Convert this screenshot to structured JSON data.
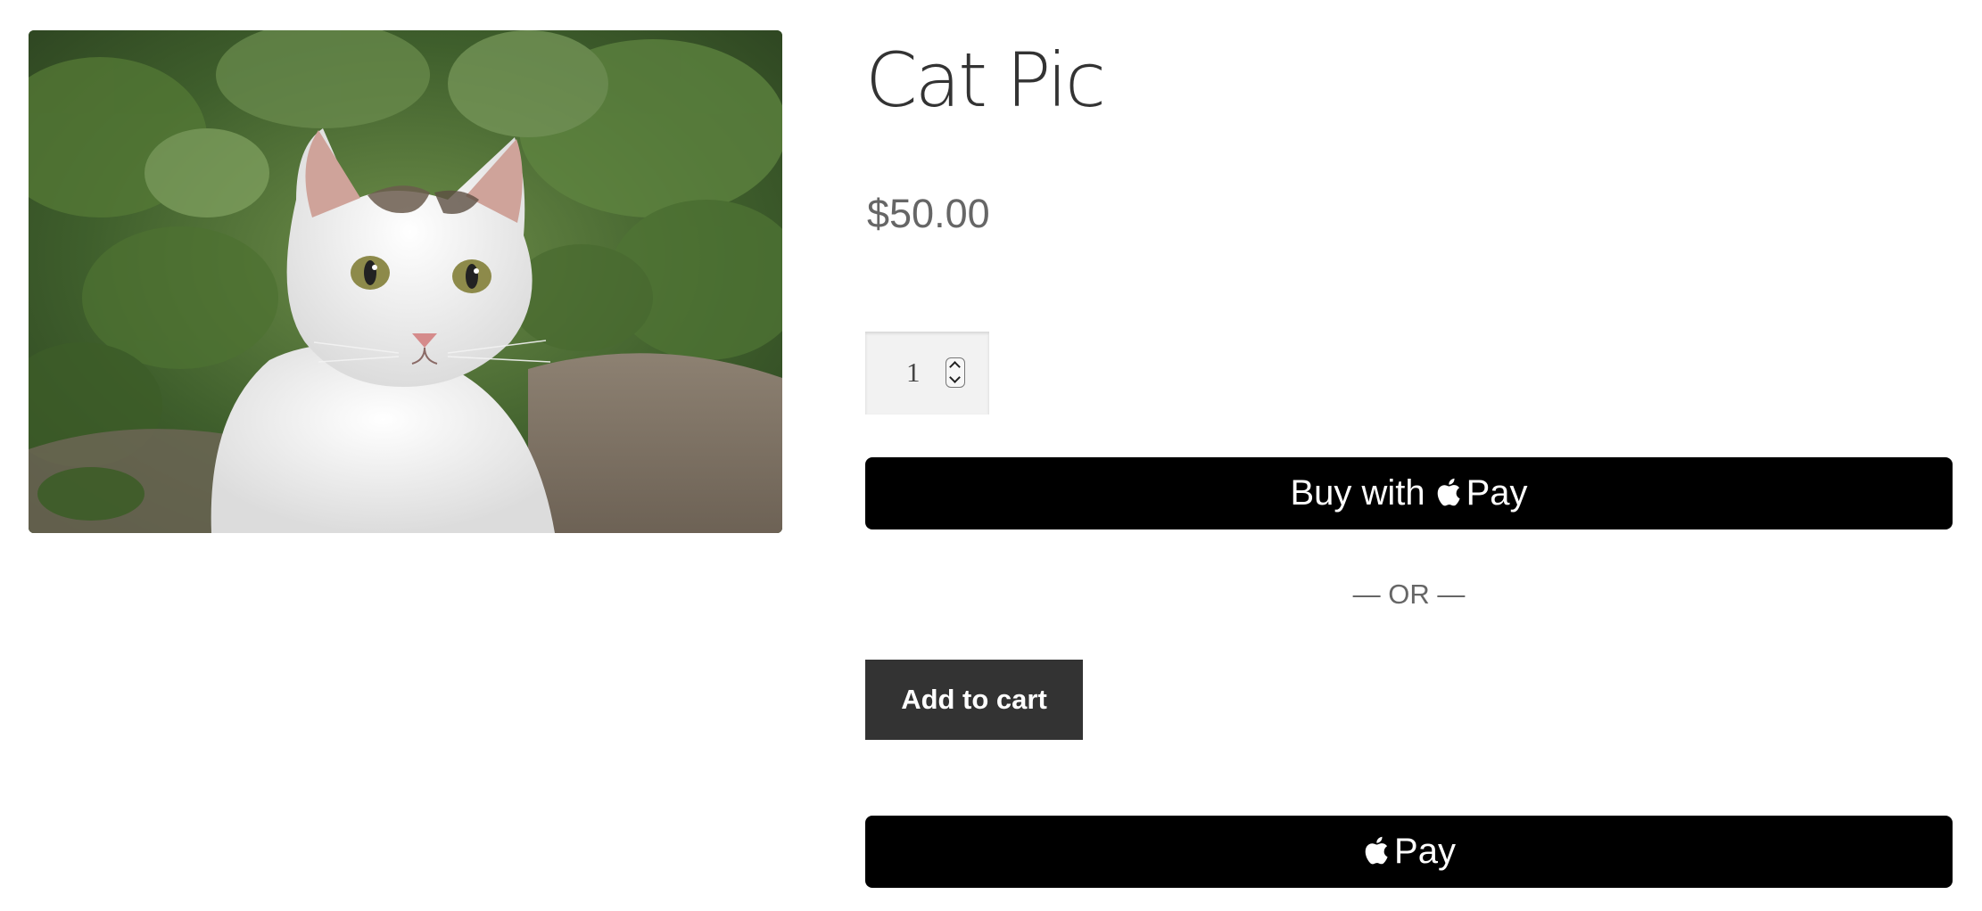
{
  "product": {
    "title": "Cat Pic",
    "price": "$50.00",
    "image_icon": "cat-photo"
  },
  "quantity": {
    "value": "1"
  },
  "buttons": {
    "buy_with_prefix": "Buy with",
    "pay_label": "Pay",
    "or_divider": "— OR —",
    "add_to_cart": "Add to cart",
    "express_pay_label": "Pay"
  },
  "icons": {
    "apple": "apple-icon",
    "stepper": "stepper-icon"
  },
  "colors": {
    "pay_button_bg": "#000000",
    "add_to_cart_bg": "#333333",
    "price_text": "#666666",
    "title_text": "#333333"
  }
}
